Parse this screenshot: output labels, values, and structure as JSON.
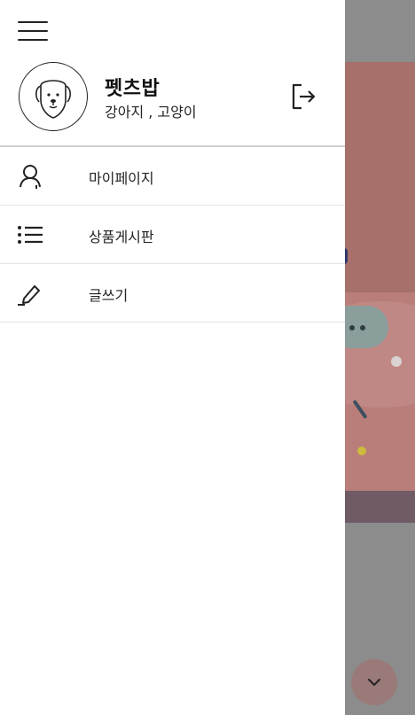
{
  "profile": {
    "name": "펫츠밥",
    "subtitle": "강아지 , 고양이",
    "avatar_icon": "dog-face-icon",
    "logout_icon": "logout-icon"
  },
  "menu_toggle_icon": "hamburger-menu-icon",
  "menu": {
    "items": [
      {
        "label": "마이페이지",
        "icon": "user-icon"
      },
      {
        "label": "상품게시판",
        "icon": "list-icon"
      },
      {
        "label": "글쓰기",
        "icon": "pen-icon"
      }
    ]
  },
  "background": {
    "scroll_button_icon": "chevron-down-icon"
  },
  "colors": {
    "drawer_bg": "#ffffff",
    "overlay": "#8c8c8c",
    "hero": "#b97e79",
    "text": "#222222"
  }
}
